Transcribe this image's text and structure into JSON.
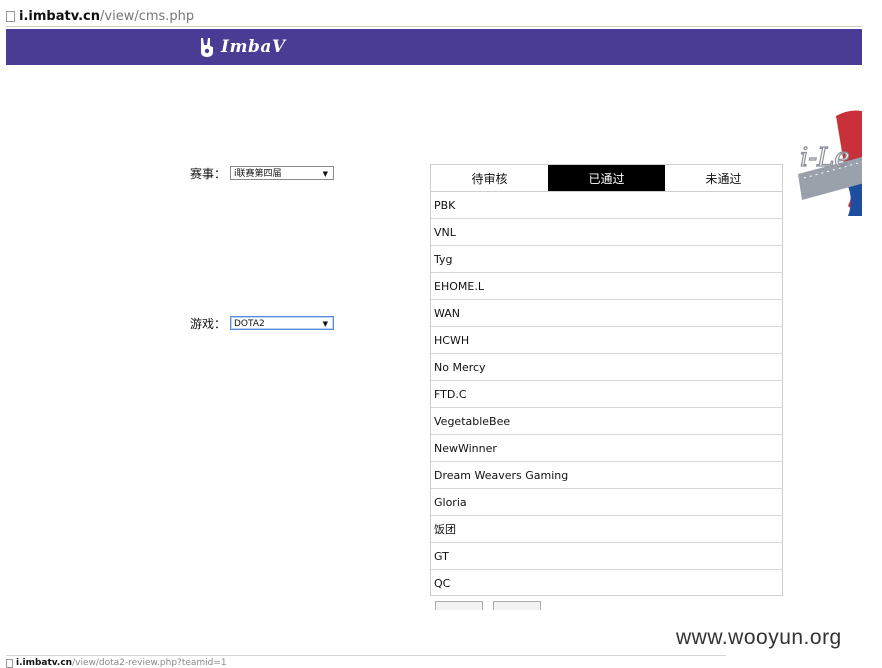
{
  "browser": {
    "top_url": {
      "host": "i.imbatv.cn",
      "path": "/view/cms.php"
    },
    "bottom_url": {
      "host": "i.imbatv.cn",
      "path": "/view/dota2-review.php?teamid=1"
    }
  },
  "banner": {
    "color": "#4a3b95",
    "logo_text": "ImbaV"
  },
  "filters": {
    "event": {
      "label": "赛事：",
      "value": "i联赛第四届"
    },
    "game": {
      "label": "游戏：",
      "value": "DOTA2"
    }
  },
  "review_panel": {
    "tabs": [
      {
        "label": "待审核",
        "active": false
      },
      {
        "label": "已通过",
        "active": true
      },
      {
        "label": "未通过",
        "active": false
      }
    ],
    "teams": [
      "PBK",
      "VNL",
      "Tyg",
      "EHOME.L",
      "WAN",
      "HCWH",
      "No Mercy",
      "FTD.C",
      "VegetableBee",
      "NewWinner",
      "Dream Weavers Gaming",
      "Gloria",
      "饭团",
      "GT",
      "QC"
    ]
  },
  "watermark": "www.wooyun.org"
}
